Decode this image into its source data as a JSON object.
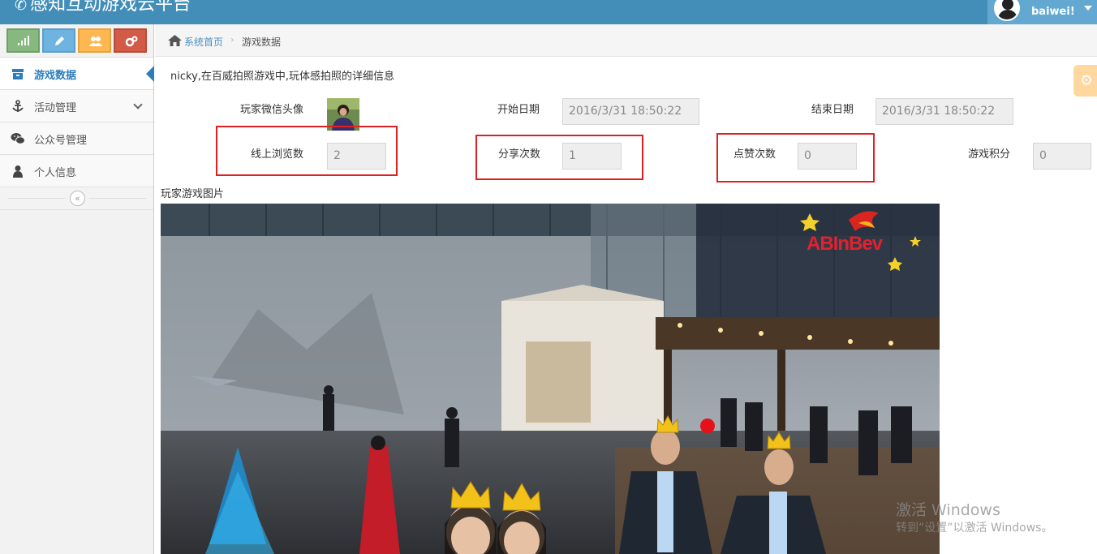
{
  "app": {
    "title": "感知互动游戏云平台",
    "user_name": "baiwei!",
    "colors": {
      "navbar": "#438eb9",
      "accent": "#2b7dbc",
      "highlight": "#e02020"
    }
  },
  "shortcuts": [
    {
      "icon": "signal-icon",
      "color": "#87b87f"
    },
    {
      "icon": "pencil-icon",
      "color": "#6fb3e0"
    },
    {
      "icon": "users-icon",
      "color": "#ffb752"
    },
    {
      "icon": "cogs-icon",
      "color": "#d15b47"
    }
  ],
  "sidebar": {
    "items": [
      {
        "label": "游戏数据",
        "icon": "archive-icon",
        "active": true
      },
      {
        "label": "活动管理",
        "icon": "anchor-icon",
        "has_submenu": true
      },
      {
        "label": "公众号管理",
        "icon": "wechat-icon"
      },
      {
        "label": "个人信息",
        "icon": "user-icon"
      }
    ],
    "collapse_glyph": "«"
  },
  "breadcrumb": {
    "home": "系统首页",
    "separator": "›",
    "current": "游戏数据"
  },
  "content": {
    "description": "nicky,在百威拍照游戏中,玩体感拍照的详细信息",
    "fields": {
      "avatar_label": "玩家微信头像",
      "start_label": "开始日期",
      "start_value": "2016/3/31 18:50:22",
      "end_label": "结束日期",
      "end_value": "2016/3/31 18:50:22",
      "views_label": "线上浏览数",
      "views_value": "2",
      "shares_label": "分享次数",
      "shares_value": "1",
      "likes_label": "点赞次数",
      "likes_value": "0",
      "score_label": "游戏积分",
      "score_value": "0"
    },
    "photo_label": "玩家游戏图片",
    "photo_logo": "ABInBev"
  },
  "watermark": {
    "line1": "激活 Windows",
    "line2": "转到“设置”以激活 Windows。"
  }
}
